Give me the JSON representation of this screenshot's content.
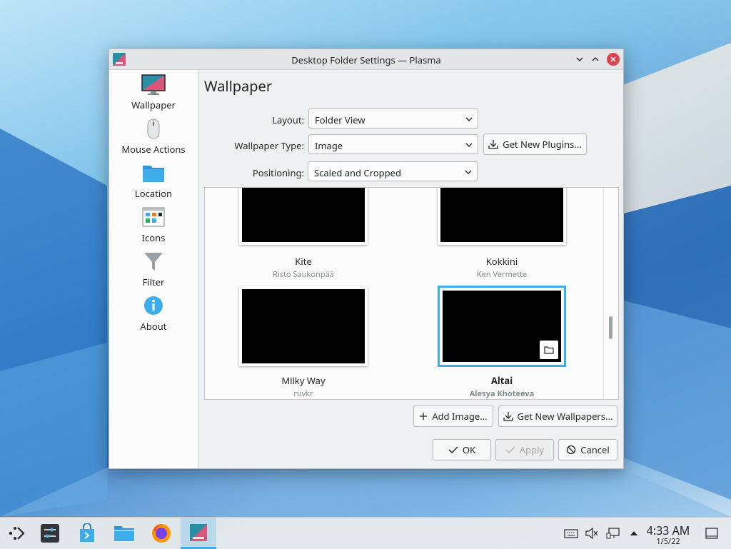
{
  "window": {
    "title": "Desktop Folder Settings — Plasma"
  },
  "sidebar": {
    "items": [
      {
        "label": "Wallpaper"
      },
      {
        "label": "Mouse Actions"
      },
      {
        "label": "Location"
      },
      {
        "label": "Icons"
      },
      {
        "label": "Filter"
      },
      {
        "label": "About"
      }
    ]
  },
  "page": {
    "heading": "Wallpaper",
    "layout_label": "Layout:",
    "layout_value": "Folder View",
    "type_label": "Wallpaper Type:",
    "type_value": "Image",
    "get_plugins": "Get New Plugins...",
    "positioning_label": "Positioning:",
    "positioning_value": "Scaled and Cropped"
  },
  "wallpapers": [
    {
      "name": "Kite",
      "author": "Risto Saukonpää",
      "selected": false
    },
    {
      "name": "Kokkini",
      "author": "Ken Vermette",
      "selected": false
    },
    {
      "name": "Milky Way",
      "author": "ruvkr",
      "selected": false
    },
    {
      "name": "Altai",
      "author": "Alesya Khoteeva",
      "selected": true
    }
  ],
  "actions": {
    "add_image": "Add Image...",
    "get_wallpapers": "Get New Wallpapers...",
    "ok": "OK",
    "apply": "Apply",
    "cancel": "Cancel"
  },
  "taskbar": {
    "time": "4:33 AM",
    "date": "1/5/22"
  },
  "colors": {
    "accent": "#3daee9",
    "close": "#da4453"
  }
}
